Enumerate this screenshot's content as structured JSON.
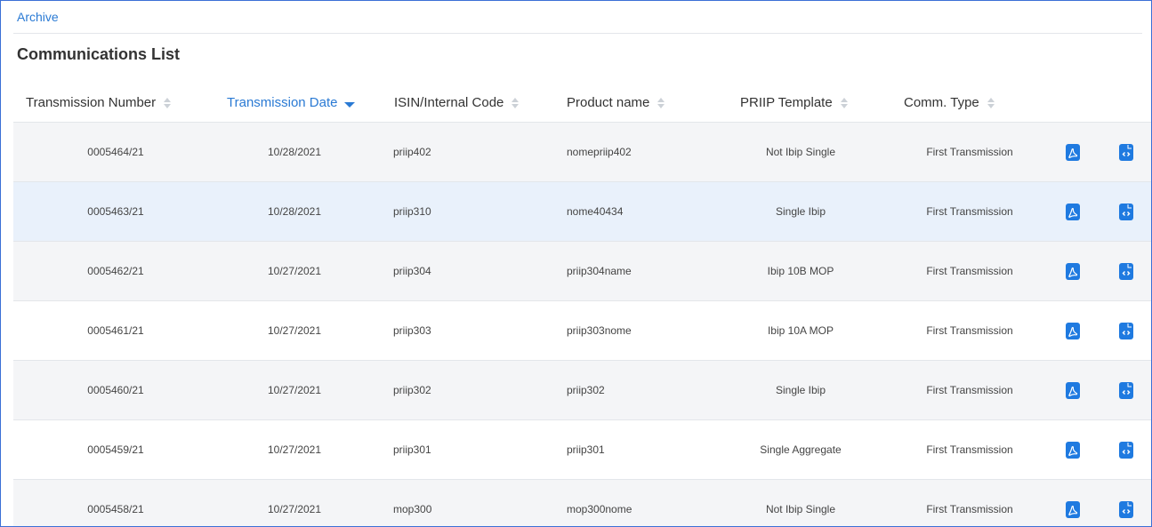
{
  "breadcrumb": "Archive",
  "title": "Communications List",
  "columns": {
    "transmission_number": "Transmission Number",
    "transmission_date": "Transmission Date",
    "isin": "ISIN/Internal Code",
    "product_name": "Product name",
    "priip_template": "PRIIP Template",
    "comm_type": "Comm. Type"
  },
  "colors": {
    "accent": "#2a7ad4",
    "icon_blue": "#1f7ae0",
    "border": "#3b6fd6"
  },
  "icons": {
    "pdf": "pdf-file-icon",
    "xml": "xml-file-icon"
  },
  "rows": [
    {
      "number": "0005464/21",
      "date": "10/28/2021",
      "isin": "priip402",
      "product": "nomepriip402",
      "template": "Not Ibip Single",
      "comm": "First Transmission"
    },
    {
      "number": "0005463/21",
      "date": "10/28/2021",
      "isin": "priip310",
      "product": "nome40434",
      "template": "Single Ibip",
      "comm": "First Transmission"
    },
    {
      "number": "0005462/21",
      "date": "10/27/2021",
      "isin": "priip304",
      "product": "priip304name",
      "template": "Ibip 10B MOP",
      "comm": "First Transmission"
    },
    {
      "number": "0005461/21",
      "date": "10/27/2021",
      "isin": "priip303",
      "product": "priip303nome",
      "template": "Ibip 10A MOP",
      "comm": "First Transmission"
    },
    {
      "number": "0005460/21",
      "date": "10/27/2021",
      "isin": "priip302",
      "product": "priip302",
      "template": "Single Ibip",
      "comm": "First Transmission"
    },
    {
      "number": "0005459/21",
      "date": "10/27/2021",
      "isin": "priip301",
      "product": "priip301",
      "template": "Single Aggregate",
      "comm": "First Transmission"
    },
    {
      "number": "0005458/21",
      "date": "10/27/2021",
      "isin": "mop300",
      "product": "mop300nome",
      "template": "Not Ibip Single",
      "comm": "First Transmission"
    }
  ]
}
